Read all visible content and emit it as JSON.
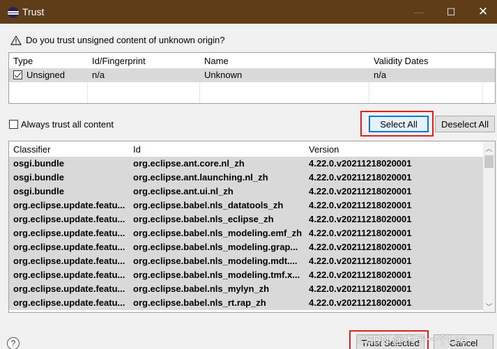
{
  "window": {
    "title": "Trust",
    "minimize_glyph": "—",
    "maximize_glyph": "☐",
    "close_glyph": "✕"
  },
  "question": "Do you trust unsigned content of unknown origin?",
  "trust_table": {
    "headers": [
      "Type",
      "Id/Fingerprint",
      "Name",
      "Validity Dates"
    ],
    "rows": [
      {
        "checked": true,
        "type": "Unsigned",
        "id": "n/a",
        "name": "Unknown",
        "validity": "n/a"
      }
    ]
  },
  "always_trust_label": "Always trust all content",
  "buttons": {
    "select_all": "Select All",
    "deselect_all": "Deselect All",
    "trust_selected": "Trust Selected",
    "cancel": "Cancel"
  },
  "list": {
    "headers": [
      "Classifier",
      "Id",
      "Version"
    ],
    "rows": [
      {
        "classifier": "osgi.bundle",
        "id": "org.eclipse.ant.core.nl_zh",
        "version": "4.22.0.v20211218020001"
      },
      {
        "classifier": "osgi.bundle",
        "id": "org.eclipse.ant.launching.nl_zh",
        "version": "4.22.0.v20211218020001"
      },
      {
        "classifier": "osgi.bundle",
        "id": "org.eclipse.ant.ui.nl_zh",
        "version": "4.22.0.v20211218020001"
      },
      {
        "classifier": "org.eclipse.update.featu...",
        "id": "org.eclipse.babel.nls_datatools_zh",
        "version": "4.22.0.v20211218020001"
      },
      {
        "classifier": "org.eclipse.update.featu...",
        "id": "org.eclipse.babel.nls_eclipse_zh",
        "version": "4.22.0.v20211218020001"
      },
      {
        "classifier": "org.eclipse.update.featu...",
        "id": "org.eclipse.babel.nls_modeling.emf_zh",
        "version": "4.22.0.v20211218020001"
      },
      {
        "classifier": "org.eclipse.update.featu...",
        "id": "org.eclipse.babel.nls_modeling.grap...",
        "version": "4.22.0.v20211218020001"
      },
      {
        "classifier": "org.eclipse.update.featu...",
        "id": "org.eclipse.babel.nls_modeling.mdt....",
        "version": "4.22.0.v20211218020001"
      },
      {
        "classifier": "org.eclipse.update.featu...",
        "id": "org.eclipse.babel.nls_modeling.tmf.x...",
        "version": "4.22.0.v20211218020001"
      },
      {
        "classifier": "org.eclipse.update.featu...",
        "id": "org.eclipse.babel.nls_mylyn_zh",
        "version": "4.22.0.v20211218020001"
      },
      {
        "classifier": "org.eclipse.update.featu...",
        "id": "org.eclipse.babel.nls_rt.rap_zh",
        "version": "4.22.0.v20211218020001"
      }
    ]
  },
  "help_glyph": "?",
  "watermark": "CSDN @木子一个Lee",
  "colors": {
    "titlebar": "#5f3d18",
    "selected_row": "#d9d9d9",
    "highlight_box": "#e0201c",
    "focus_blue": "#0078d7"
  }
}
